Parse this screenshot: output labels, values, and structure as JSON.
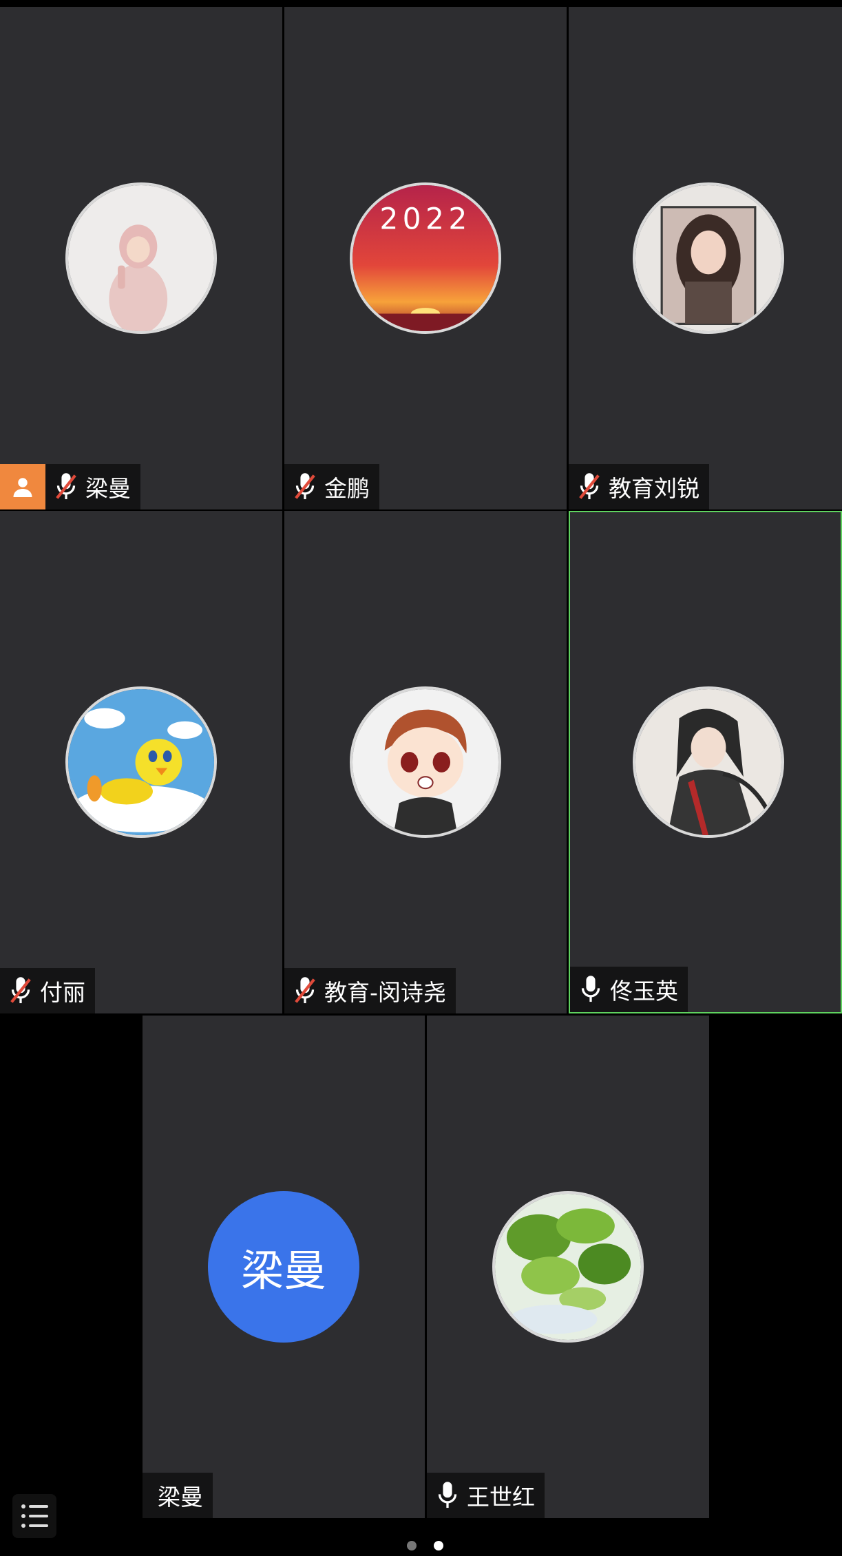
{
  "participants": [
    {
      "name": "梁曼",
      "mic": "muted",
      "host": true
    },
    {
      "name": "金鹏",
      "mic": "muted"
    },
    {
      "name": "教育刘锐",
      "mic": "muted"
    },
    {
      "name": "付丽",
      "mic": "muted"
    },
    {
      "name": "教育-闵诗尧",
      "mic": "muted"
    },
    {
      "name": "佟玉英",
      "mic": "on",
      "speaking": true
    },
    {
      "name": "梁曼",
      "mic": "none",
      "avatar_text": "梁曼"
    },
    {
      "name": "王世红",
      "mic": "on"
    }
  ],
  "avatar_2_text": "2022",
  "pager": {
    "count": 2,
    "active": 2
  },
  "colors": {
    "tile": "#2d2d30",
    "host_badge": "#f0883e",
    "speaking_border": "#5fd35f",
    "initials_avatar": "#3a74ea",
    "muted_slash": "#e04a3a"
  }
}
